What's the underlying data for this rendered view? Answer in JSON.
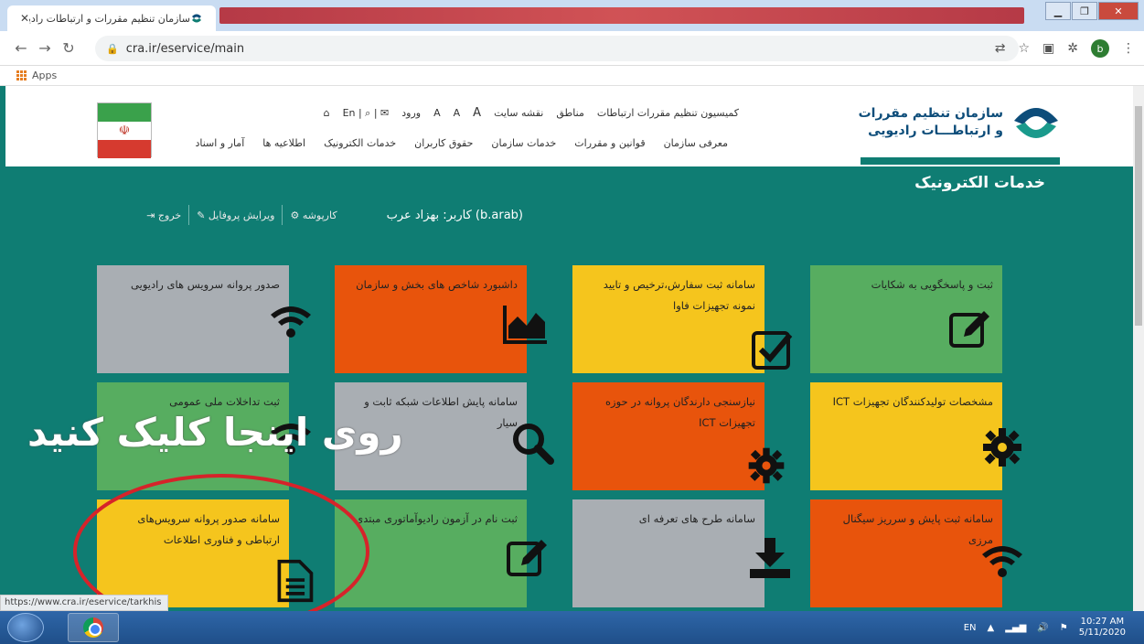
{
  "browser": {
    "tab_title": "سازمان تنظیم مقررات و ارتباطات رادیویی",
    "tab_close": "✕",
    "url": "cra.ir/eservice/main",
    "bookmarks_apps": "Apps",
    "profile_initial": "b"
  },
  "header": {
    "logo_line1": "سازمان تنظیم مقررات",
    "logo_line2": "و ارتباطـــات رادیویی",
    "top_links": [
      "کمیسیون تنظیم مقررات ارتباطات",
      "مناطق",
      "نقشه سایت",
      "A",
      "A",
      "A",
      "ورود",
      "En | ⌕ | ✉"
    ],
    "main_nav": [
      "معرفی سازمان",
      "قوانین و مقررات",
      "خدمات سازمان",
      "حقوق کاربران",
      "خدمات الکترونیک",
      "اطلاعیه ها",
      "آمار و اسناد"
    ]
  },
  "section_title": "خدمات الکترونیک",
  "user_bar": {
    "user": "کاربر: بهزاد عرب (b.arab)",
    "dashboard": "کارپوشه",
    "edit_profile": "ویرایش پروفایل",
    "logout": "خروج"
  },
  "tiles": {
    "t1": "ثبت و پاسخگویی به شکایات",
    "t2": "سامانه ثبت سفارش،ترخیص و تایید نمونه تجهیزات فاوا",
    "t3": "داشبورد شاخص های بخش و سازمان",
    "t4": "صدور پروانه سرویس های رادیویی",
    "t5": "مشخصات تولیدکنندگان تجهیزات ICT",
    "t6": "نیازسنجی دارندگان پروانه در حوزه تجهیزات ICT",
    "t7": "سامانه پایش اطلاعات شبکه ثابت و سیار",
    "t8": "ثبت تداخلات ملی عمومی",
    "t9": "سامانه ثبت پایش و سرریز سیگنال مرزی",
    "t10": "سامانه طرح های تعرفه ای",
    "t11": "ثبت نام در آزمون رادیوآماتوری مبتدی",
    "t12": "سامانه صدور پروانه سرویس‌های ارتباطی و فناوری اطلاعات"
  },
  "overlay_text": "روی اینجا کلیک کنید",
  "status_url": "https://www.cra.ir/eservice/tarkhis",
  "taskbar": {
    "lang": "EN",
    "time": "10:27 AM",
    "date": "5/11/2020"
  },
  "colors": {
    "page_bg": "#0f7d73",
    "tile_green": "#57ad60",
    "tile_orange": "#e8540c",
    "tile_yellow": "#f5c51d",
    "tile_gray": "#a9aeb3",
    "annotation_red": "#d6232a"
  }
}
